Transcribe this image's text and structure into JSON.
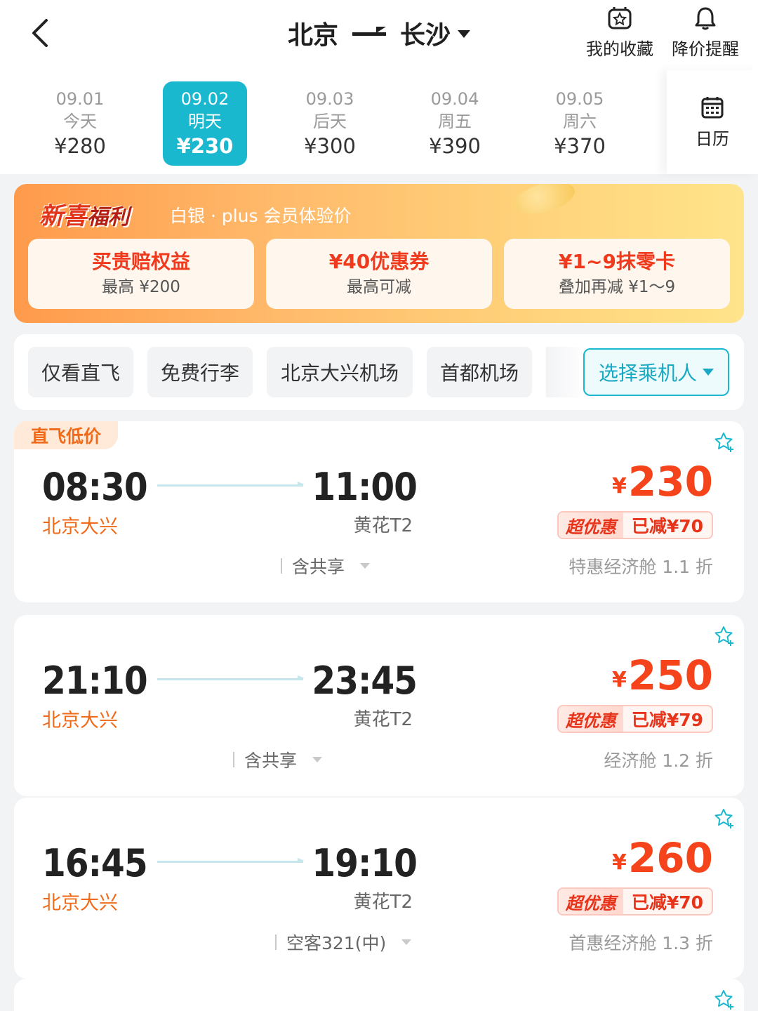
{
  "header": {
    "origin": "北京",
    "destination": "长沙",
    "favorites_label": "我的收藏",
    "price_alert_label": "降价提醒"
  },
  "dates": [
    {
      "date": "09.01",
      "weekday": "今天",
      "price": "¥280",
      "active": false
    },
    {
      "date": "09.02",
      "weekday": "明天",
      "price": "¥230",
      "active": true
    },
    {
      "date": "09.03",
      "weekday": "后天",
      "price": "¥300",
      "active": false
    },
    {
      "date": "09.04",
      "weekday": "周五",
      "price": "¥390",
      "active": false
    },
    {
      "date": "09.05",
      "weekday": "周六",
      "price": "¥370",
      "active": false
    }
  ],
  "calendar_label": "日历",
  "promo": {
    "title_part1": "新喜",
    "title_part2": "福利",
    "subtitle": "白银 · plus 会员体验价",
    "cards": [
      {
        "title": "买贵赔权益",
        "sub": "最高 ¥200"
      },
      {
        "title": "¥40优惠券",
        "sub": "最高可减"
      },
      {
        "title": "¥1~9抹零卡",
        "sub": "叠加再减 ¥1～9"
      }
    ]
  },
  "filters": {
    "chips": [
      "仅看直飞",
      "免费行李",
      "北京大兴机场",
      "首都机场"
    ],
    "select_passenger": "选择乘机人"
  },
  "flights": [
    {
      "tag": "直飞低价",
      "dep_time": "08:30",
      "dep_airport": "北京大兴",
      "arr_time": "11:00",
      "arr_airport": "黄花T2",
      "meal": "含共享",
      "currency": "¥",
      "price": "230",
      "badge_left": "超优惠",
      "badge_right": "已减¥70",
      "cabin": "特惠经济舱 1.1 折"
    },
    {
      "tag": "",
      "dep_time": "21:10",
      "dep_airport": "北京大兴",
      "arr_time": "23:45",
      "arr_airport": "黄花T2",
      "meal": "含共享",
      "currency": "¥",
      "price": "250",
      "badge_left": "超优惠",
      "badge_right": "已减¥79",
      "cabin": "经济舱 1.2 折"
    },
    {
      "tag": "",
      "dep_time": "16:45",
      "dep_airport": "北京大兴",
      "arr_time": "19:10",
      "arr_airport": "黄花T2",
      "meal": "空客321(中)",
      "currency": "¥",
      "price": "260",
      "badge_left": "超优惠",
      "badge_right": "已减¥70",
      "cabin": "首惠经济舱 1.3 折"
    }
  ],
  "icons": {
    "back": "chevron-left-icon",
    "favorites": "star-box-icon",
    "alert": "bell-icon",
    "calendar": "calendar-icon",
    "fav": "star-plus-icon"
  },
  "colors": {
    "accent": "#19b8cf",
    "price": "#f5431b",
    "airport": "#f06a19"
  }
}
